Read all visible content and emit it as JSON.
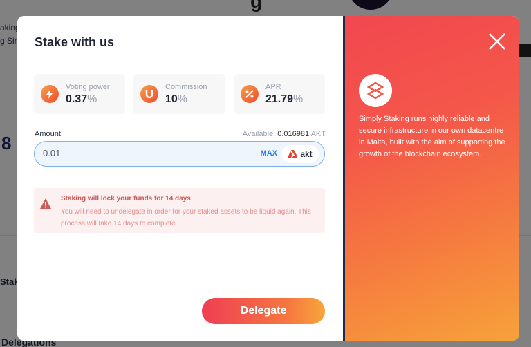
{
  "background": {
    "text1": "aking",
    "text2": "g Sim",
    "number": "8",
    "stak": "Stak",
    "delegations": "Delegations"
  },
  "modal": {
    "title": "Stake with us",
    "stats": [
      {
        "label": "Voting power",
        "value": "0.37",
        "unit": "%",
        "icon": "lightning-icon"
      },
      {
        "label": "Commission",
        "value": "10",
        "unit": "%",
        "icon": "magnet-icon"
      },
      {
        "label": "APR",
        "value": "21.79",
        "unit": "%",
        "icon": "percent-icon"
      }
    ],
    "amount": {
      "label": "Amount",
      "available_label": "Available:",
      "available_value": "0.016981",
      "available_unit": "AKT",
      "input_value": "0.01",
      "max_label": "MAX",
      "token": "akt"
    },
    "warning": {
      "title": "Staking will lock your funds for 14 days",
      "description": "You will need to undelegate in order for your staked assets to be liquid again. This process will take 14 days to complete."
    },
    "delegate_label": "Delegate",
    "validator_description": "Simply Staking runs highly reliable and secure infrastructure in our own datacentre in Malta, built with the aim of supporting the growth of the blockchain ecosystem."
  },
  "colors": {
    "accent_gradient_start": "#f03e54",
    "accent_gradient_end": "#f8a53b",
    "link": "#2f7be0",
    "warning_text": "#c85a5a"
  }
}
